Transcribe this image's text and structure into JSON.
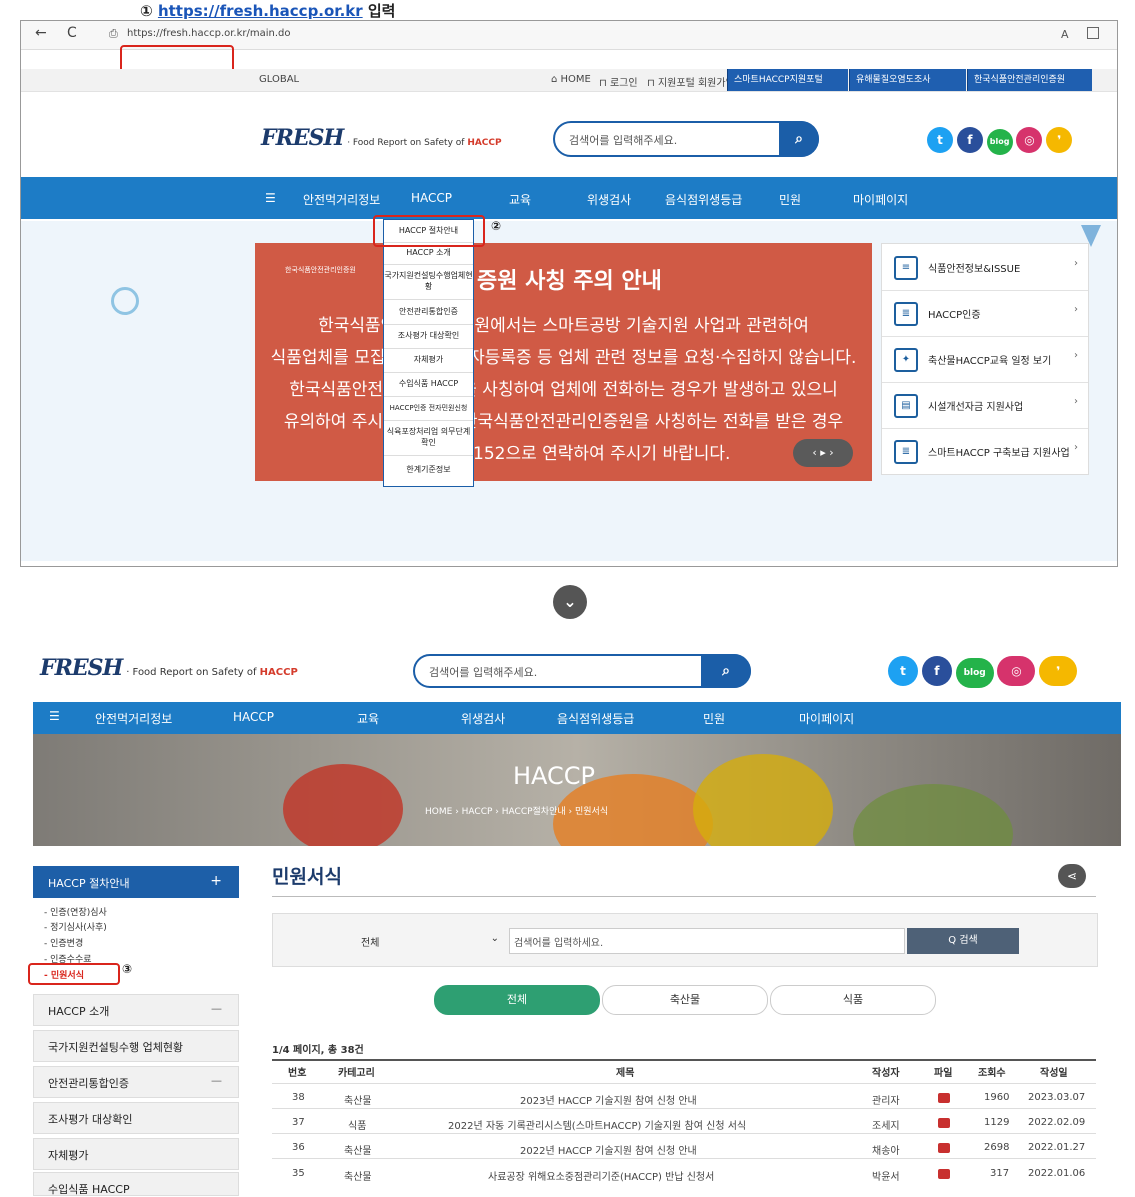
{
  "caption1": {
    "num": "①",
    "url": "https://fresh.haccp.or.kr",
    "action": "입력"
  },
  "browser": {
    "back": "←",
    "reload": "C",
    "url": "https://fresh.haccp.or.kr/main.do",
    "reader": "A"
  },
  "global_bar": {
    "global": "GLOBAL",
    "home": "HOME",
    "login": "로그인",
    "join": "지원포털 회원가입",
    "portals": [
      "스마트HACCP지원포털",
      "유해물질오염도조사",
      "한국식품안전관리인증원"
    ]
  },
  "logo": {
    "main": "FRESH",
    "sub_prefix": "· Food Report on Safety of ",
    "sub_brand": "HACCP"
  },
  "search": {
    "placeholder": "검색어를 입력해주세요."
  },
  "social": [
    "twitter",
    "facebook",
    "blog",
    "instagram",
    "kakao"
  ],
  "social_labels": {
    "blog": "blog"
  },
  "nav": [
    "안전먹거리정보",
    "HACCP",
    "교육",
    "위생검사",
    "음식점위생등급",
    "민원",
    "마이페이지"
  ],
  "dropdown": {
    "highlight_num": "②",
    "items": [
      "HACCP 절차안내",
      "HACCP 소개",
      "국가지원컨설팅수행업체현황",
      "안전관리통합인증",
      "조사평가 대상확인",
      "자체평가",
      "수입식품 HACCP",
      "HACCP인증 전자민원신청",
      "식육포장처리업 의무단계 확인",
      "한계기준정보"
    ]
  },
  "popup": {
    "org": "한국식품안전관리인증원",
    "title": "증원 사칭 주의 안내",
    "lines": [
      "한국식품안전관리인증원에서는 스마트공방 기술지원 사업과 관련하여",
      "식품업체를 모집하거나 사업자등록증 등 업체 관련 정보를 요청·수집하지 않습니다.",
      "한국식품안전관리인증원을 사칭하여 업체에 전화하는 경우가 발생하고 있으니",
      "유의하여 주시기 바라며, 한국식품안전관리인증원을 사칭하는 전화를 받은 경우",
      "043-              7, 0152으로 연락하여 주시기 바랍니다."
    ],
    "pager": "‹ ▸ ›"
  },
  "rightpanel": [
    "식품안전정보&ISSUE",
    "HACCP인증",
    "축산물HACCP교육 일정 보기",
    "시설개선자금 지원사업",
    "스마트HACCP 구축보급 지원사업"
  ],
  "down_arrow": "⌄",
  "page2": {
    "banner_title": "HACCP",
    "breadcrumb": [
      "HOME",
      "HACCP",
      "HACCP절차안내",
      "민원서식"
    ],
    "side_header": "HACCP 절차안내",
    "side_header_icon": "+",
    "side_sub": [
      "- 인증(연장)심사",
      "- 정기심사(사후)",
      "- 인증변경",
      "- 인증수수료",
      "- 민원서식"
    ],
    "side_highlight_num": "③",
    "side_items": [
      {
        "label": "HACCP 소개",
        "icon": "—"
      },
      {
        "label": "국가지원컨설팅수행 업체현황",
        "icon": ""
      },
      {
        "label": "안전관리통합인증",
        "icon": "—"
      },
      {
        "label": "조사평가 대상확인",
        "icon": ""
      },
      {
        "label": "자체평가",
        "icon": ""
      },
      {
        "label": "수입식품 HACCP",
        "icon": ""
      }
    ],
    "page_title": "민원서식",
    "share_icon": "share",
    "filter_select": "전체",
    "filter_placeholder": "검색어를 입력하세요.",
    "filter_button": "Q 검색",
    "tabs": [
      "전체",
      "축산물",
      "식품"
    ],
    "summary": "1/4 페이지, 총 38건",
    "columns": [
      "번호",
      "카테고리",
      "제목",
      "작성자",
      "파일",
      "조회수",
      "작성일"
    ],
    "rows": [
      {
        "no": "38",
        "cat": "축산물",
        "title": "2023년 HACCP 기술지원 참여 신청 안내",
        "author": "관리자",
        "views": "1960",
        "date": "2023.03.07"
      },
      {
        "no": "37",
        "cat": "식품",
        "title": "2022년 자동 기록관리시스템(스마트HACCP) 기술지원 참여 신청 서식",
        "author": "조세지",
        "views": "1129",
        "date": "2022.02.09"
      },
      {
        "no": "36",
        "cat": "축산물",
        "title": "2022년 HACCP 기술지원 참여 신청 안내",
        "author": "채송아",
        "views": "2698",
        "date": "2022.01.27"
      },
      {
        "no": "35",
        "cat": "축산물",
        "title": "사료공장 위해요소중점관리기준(HACCP) 반납 신청서",
        "author": "박윤서",
        "views": "317",
        "date": "2022.01.06"
      }
    ]
  },
  "colors": {
    "brand_blue": "#1b5ea8",
    "nav_blue": "#1d7cc6",
    "popup_red": "#d05a45",
    "highlight": "#d9251c",
    "tab_green": "#2e9f72"
  }
}
